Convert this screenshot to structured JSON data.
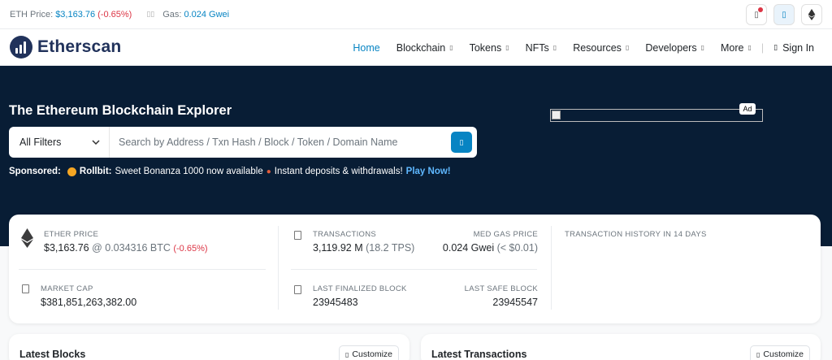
{
  "topbar": {
    "eth_price_label": "ETH Price:",
    "eth_price_value": "$3,163.76",
    "eth_price_change": "(-0.65%)",
    "gas_icon": "gas-pump-icon",
    "gas_label": "Gas:",
    "gas_value": "0.024 Gwei"
  },
  "nav": {
    "logo_text": "Etherscan",
    "items": [
      {
        "label": "Home"
      },
      {
        "label": "Blockchain"
      },
      {
        "label": "Tokens"
      },
      {
        "label": "NFTs"
      },
      {
        "label": "Resources"
      },
      {
        "label": "Developers"
      },
      {
        "label": "More"
      }
    ],
    "signin_label": "Sign In"
  },
  "hero": {
    "title": "The Ethereum Blockchain Explorer",
    "filter_label": "All Filters",
    "search_placeholder": "Search by Address / Txn Hash / Block / Token / Domain Name",
    "sponsored_label": "Sponsored:",
    "sponsor_name": "Rollbit:",
    "sponsor_text": "Sweet Bonanza 1000 now available",
    "sponsor_text2": "Instant deposits & withdrawals!",
    "sponsor_cta": "Play Now!",
    "ad_tag": "Ad"
  },
  "stats": {
    "ether_price_label": "ETHER PRICE",
    "ether_price_value": "$3,163.76",
    "ether_price_at": "@ 0.034316 BTC",
    "ether_price_change": "(-0.65%)",
    "market_cap_label": "MARKET CAP",
    "market_cap_value": "$381,851,263,382.00",
    "transactions_label": "TRANSACTIONS",
    "transactions_value": "3,119.92 M",
    "transactions_tps": "(18.2 TPS)",
    "med_gas_label": "MED GAS PRICE",
    "med_gas_value": "0.024 Gwei",
    "med_gas_usd": "(< $0.01)",
    "last_finalized_label": "LAST FINALIZED BLOCK",
    "last_finalized_value": "23945483",
    "last_safe_label": "LAST SAFE BLOCK",
    "last_safe_value": "23945547",
    "history_label": "TRANSACTION HISTORY IN 14 DAYS"
  },
  "panels": {
    "latest_blocks_title": "Latest Blocks",
    "latest_txns_title": "Latest Transactions",
    "customize_label": "Customize"
  },
  "colors": {
    "brand_blue": "#0784c3",
    "hero_bg": "#081d35",
    "logo_navy": "#21325b",
    "negative": "#dc3545"
  }
}
